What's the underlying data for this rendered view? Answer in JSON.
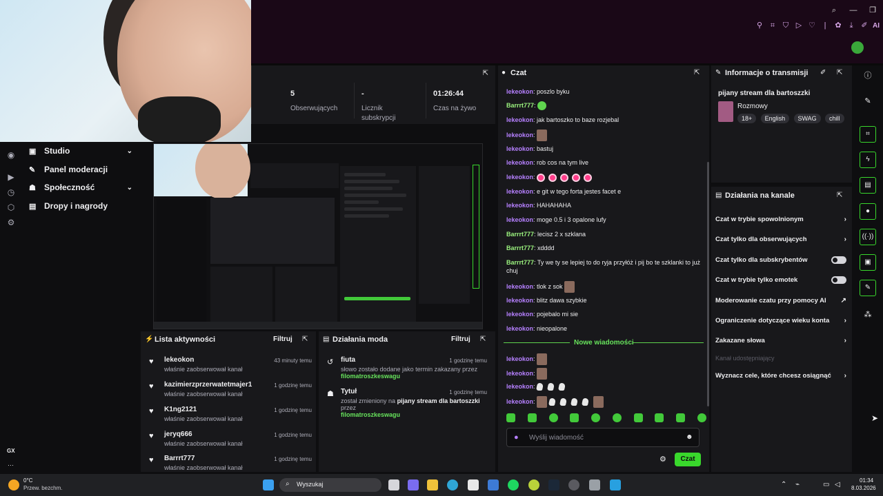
{
  "sidebar": {
    "items": [
      {
        "label": "Studio",
        "icon": "studio-icon",
        "expand": true
      },
      {
        "label": "Panel moderacji",
        "icon": "wrench-icon",
        "expand": false
      },
      {
        "label": "Społeczność",
        "icon": "community-icon",
        "expand": true
      },
      {
        "label": "Dropy i nagrody",
        "icon": "gift-icon",
        "expand": false
      }
    ],
    "gx_label": "GX",
    "more_label": "···"
  },
  "stats": [
    {
      "value": "5",
      "label": "Obserwujących"
    },
    {
      "value": "-",
      "label": "Licznik subskrypcji"
    },
    {
      "value": "01:26:44",
      "label": "Czas na żywo"
    }
  ],
  "activity": {
    "title": "Lista aktywności",
    "filter": "Filtruj",
    "items": [
      {
        "name": "lekeokon",
        "desc": "właśnie zaobserwował kanał",
        "time": "43 minuty temu"
      },
      {
        "name": "kazimierzprzerwatetmajer1",
        "desc": "właśnie zaobserwował kanał",
        "time": "1 godzinę temu"
      },
      {
        "name": "K1ng2121",
        "desc": "właśnie zaobserwował kanał",
        "time": "1 godzinę temu"
      },
      {
        "name": "jeryq666",
        "desc": "właśnie zaobserwował kanał",
        "time": "1 godzinę temu"
      },
      {
        "name": "Barrrt777",
        "desc": "właśnie zaobserwował kanał",
        "time": "1 godzinę temu"
      }
    ]
  },
  "mod": {
    "title": "Działania moda",
    "filter": "Filtruj",
    "items": [
      {
        "name": "fiuta",
        "time": "1 godzinę temu",
        "text": "słowo zostało dodane jako termin zakazany przez",
        "highlight": "filomatroszkeswagu"
      },
      {
        "name": "Tytuł",
        "time": "1 godzinę temu",
        "text_a": "został zmieniony na",
        "title_value": "pijany stream dla bartoszzki",
        "text_b": "przez",
        "highlight": "filomatroszkeswagu"
      }
    ]
  },
  "chat": {
    "title": "Czat",
    "messages": [
      {
        "user": "lekeokon",
        "text": ": poszlo byku",
        "color": "purple"
      },
      {
        "user": "Barrrt777",
        "text": ":",
        "color": "green",
        "emote": "green"
      },
      {
        "user": "lekeokon",
        "text": ": jak bartoszko to baze rozjebal",
        "color": "purple"
      },
      {
        "user": "lekeokon",
        "text": ":",
        "color": "purple",
        "emote": "photo"
      },
      {
        "user": "lekeokon",
        "text": ": bastuj",
        "color": "purple"
      },
      {
        "user": "lekeokon",
        "text": ": rob cos na tym live",
        "color": "purple"
      },
      {
        "user": "lekeokon",
        "text": ":",
        "color": "purple",
        "emote": "pink"
      },
      {
        "user": "lekeokon",
        "text": ": e git w tego forta jestes facet e",
        "color": "purple"
      },
      {
        "user": "lekeokon",
        "text": ": HAHAHAHA",
        "color": "purple"
      },
      {
        "user": "lekeokon",
        "text": ": moge 0.5 i 3 opalone lufy",
        "color": "purple"
      },
      {
        "user": "Barrrt777",
        "text": ": lecisz 2 x szklana",
        "color": "green"
      },
      {
        "user": "Barrrt777",
        "text": ": xdddd",
        "color": "green"
      },
      {
        "user": "Barrrt777",
        "text": ": Ty we ty se lepiej to do ryja przyłóż i pij bo te szklanki to już chuj",
        "color": "green"
      },
      {
        "user": "lekeokon",
        "text": ": tlok z sok",
        "color": "purple",
        "emote": "photo"
      },
      {
        "user": "lekeokon",
        "text": ": blitz dawa szybkie",
        "color": "purple"
      },
      {
        "user": "lekeokon",
        "text": ": pojebalo mi sie",
        "color": "purple"
      },
      {
        "user": "lekeokon",
        "text": ": nieopalone",
        "color": "purple"
      }
    ],
    "new_messages_label": "Nowe wiadomości",
    "new_messages": [
      {
        "user": "lekeokon",
        "text": ":",
        "emote": "photo"
      },
      {
        "user": "lekeokon",
        "text": ":",
        "emote": "photo"
      },
      {
        "user": "lekeokon",
        "text": ":",
        "emote": "white3"
      },
      {
        "user": "lekeokon",
        "text": ":",
        "emote": "mixed"
      }
    ],
    "input_placeholder": "Wyślij wiadomość",
    "send_label": "Czat"
  },
  "info": {
    "title": "Informacje o transmisji",
    "stream_title": "pijany stream dla bartoszzki",
    "category": "Rozmowy",
    "tags": [
      "18+",
      "English",
      "SWAG",
      "chill"
    ]
  },
  "actions": {
    "title": "Działania na kanale",
    "items": [
      {
        "label": "Czat w trybie spowolnionym",
        "kind": "chevron"
      },
      {
        "label": "Czat tylko dla obserwujących",
        "kind": "chevron"
      },
      {
        "label": "Czat tylko dla subskrybentów",
        "kind": "toggle"
      },
      {
        "label": "Czat w trybie tylko emotek",
        "kind": "toggle"
      },
      {
        "label": "Moderowanie czatu przy pomocy AI",
        "kind": "external"
      },
      {
        "label": "Ograniczenie dotyczące wieku konta",
        "kind": "chevron"
      },
      {
        "label": "Zakazane słowa",
        "kind": "chevron"
      },
      {
        "label": "Kanał udostępniający",
        "kind": "disabled"
      },
      {
        "label": "Wyznacz cele, które chcesz osiągnąć",
        "kind": "chevron"
      }
    ]
  },
  "taskbar": {
    "weather_temp": "0°C",
    "weather_desc": "Przew. bezchm.",
    "search_placeholder": "Wyszukaj",
    "time": "01:34",
    "date": "8.03.2026"
  },
  "colors": {
    "accent_green": "#39d82c",
    "user_purple": "#b680ff",
    "user_green": "#9cf47f",
    "topbar": "#1a0817"
  }
}
